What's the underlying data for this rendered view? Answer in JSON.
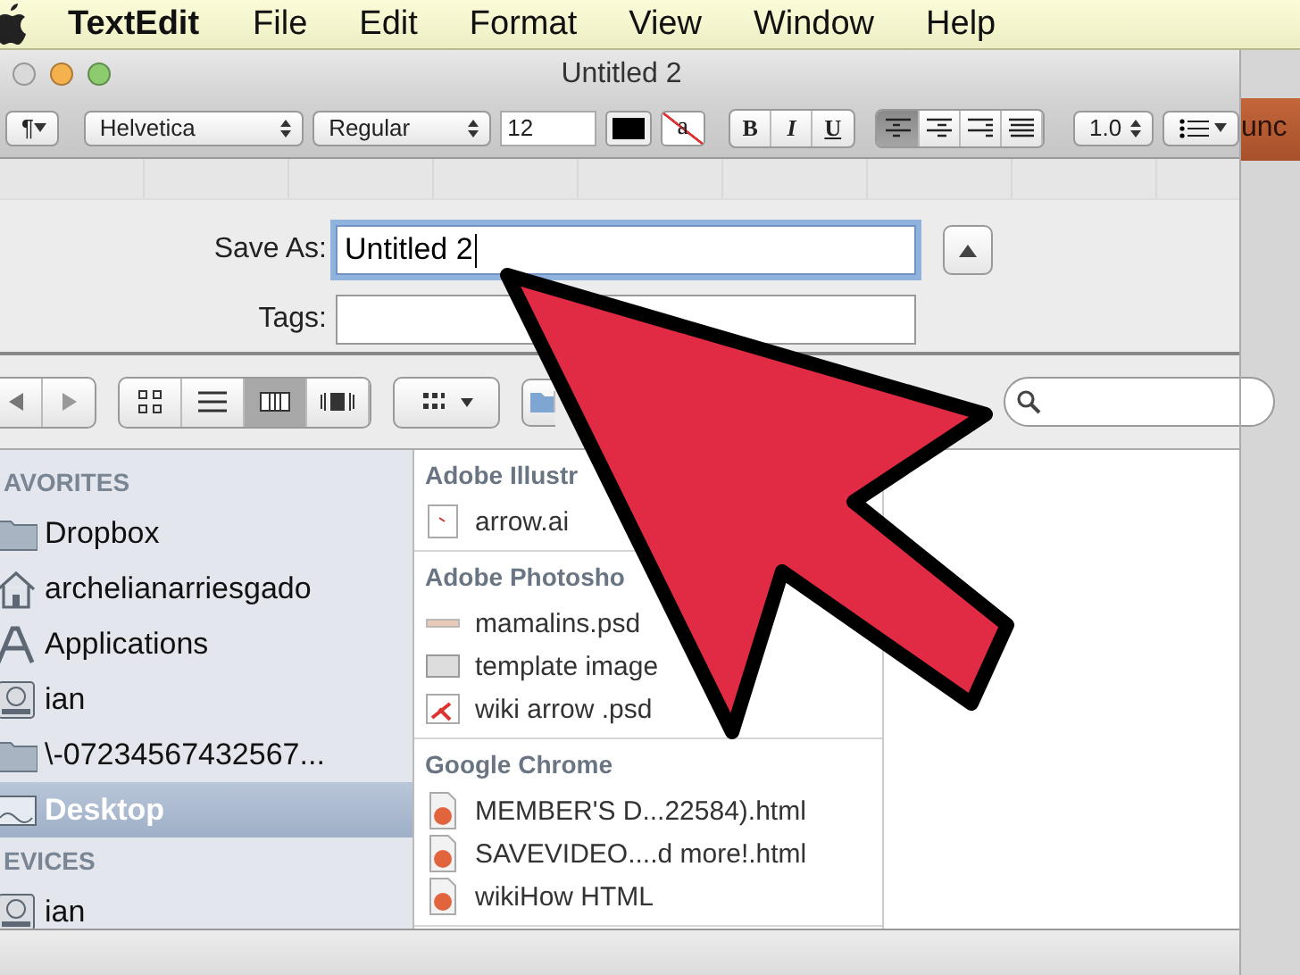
{
  "menu_bar": {
    "app": "TextEdit",
    "items": [
      "File",
      "Edit",
      "Format",
      "View",
      "Window",
      "Help"
    ]
  },
  "background_window": {
    "text": "unc"
  },
  "window": {
    "title": "Untitled 2"
  },
  "toolbar": {
    "paragraph": "¶",
    "font": "Helvetica",
    "style": "Regular",
    "size": "12",
    "background_letter": "a",
    "bold": "B",
    "italic": "I",
    "underline": "U",
    "alignments": [
      {
        "kind": "left",
        "selected": true
      },
      {
        "kind": "center",
        "selected": false
      },
      {
        "kind": "right",
        "selected": false
      },
      {
        "kind": "justify",
        "selected": false
      }
    ],
    "spacing": "1.0"
  },
  "save": {
    "label": "Save As:",
    "value": "Untitled 2",
    "tags_label": "Tags:"
  },
  "browser": {
    "views": [
      {
        "kind": "icons",
        "selected": false
      },
      {
        "kind": "list",
        "selected": false
      },
      {
        "kind": "columns",
        "selected": true
      },
      {
        "kind": "coverflow",
        "selected": false
      }
    ],
    "sidebar": [
      {
        "title": "AVORITES",
        "items": [
          {
            "label": "Dropbox",
            "kind": "folder",
            "selected": false
          },
          {
            "label": "archelianarriesgado",
            "kind": "home",
            "selected": false
          },
          {
            "label": "Applications",
            "kind": "apps",
            "selected": false
          },
          {
            "label": "ian",
            "kind": "disk",
            "selected": false
          },
          {
            "label": "\\-07234567432567...",
            "kind": "folder",
            "selected": false
          },
          {
            "label": "Desktop",
            "kind": "desktop",
            "selected": true
          }
        ]
      },
      {
        "title": "EVICES",
        "items": [
          {
            "label": "ian",
            "kind": "disk",
            "selected": false
          }
        ]
      }
    ],
    "column": [
      {
        "title": "Adobe Illustr",
        "items": [
          {
            "name": "arrow.ai",
            "kind": "ai"
          }
        ]
      },
      {
        "title": "Adobe Photosho",
        "items": [
          {
            "name": "mamalins.psd",
            "kind": "line"
          },
          {
            "name": "template image",
            "kind": "image"
          },
          {
            "name": "wiki arrow .psd",
            "kind": "psd"
          }
        ]
      },
      {
        "title": "Google Chrome",
        "items": [
          {
            "name": "MEMBER'S D...22584).html",
            "kind": "html"
          },
          {
            "name": "SAVEVIDEO....d more!.html",
            "kind": "html"
          },
          {
            "name": "wikiHow HTML",
            "kind": "html"
          }
        ]
      }
    ]
  }
}
